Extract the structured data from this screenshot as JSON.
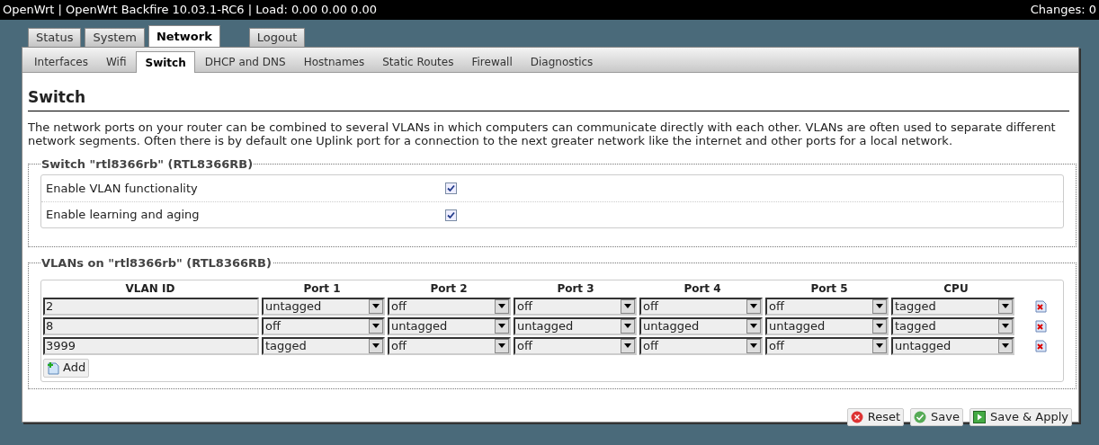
{
  "header": {
    "title": "OpenWrt | OpenWrt Backfire 10.03.1-RC6 | Load: 0.00 0.00 0.00",
    "changes": "Changes: 0"
  },
  "tabs": [
    {
      "label": "Status",
      "selected": false
    },
    {
      "label": "System",
      "selected": false
    },
    {
      "label": "Network",
      "selected": true
    },
    {
      "label": "Logout",
      "selected": false
    }
  ],
  "subtabs": [
    {
      "label": "Interfaces",
      "selected": false
    },
    {
      "label": "Wifi",
      "selected": false
    },
    {
      "label": "Switch",
      "selected": true
    },
    {
      "label": "DHCP and DNS",
      "selected": false
    },
    {
      "label": "Hostnames",
      "selected": false
    },
    {
      "label": "Static Routes",
      "selected": false
    },
    {
      "label": "Firewall",
      "selected": false
    },
    {
      "label": "Diagnostics",
      "selected": false
    }
  ],
  "page_title": "Switch",
  "description": "The network ports on your router can be combined to several VLANs in which computers can communicate directly with each other. VLANs are often used to separate different network segments. Often there is by default one Uplink port for a connection to the next greater network like the internet and other ports for a local network.",
  "switch_section": {
    "legend": "Switch \"rtl8366rb\" (RTL8366RB)",
    "options": [
      {
        "label": "Enable VLAN functionality",
        "checked": true
      },
      {
        "label": "Enable learning and aging",
        "checked": true
      }
    ]
  },
  "vlan_section": {
    "legend": "VLANs on \"rtl8366rb\" (RTL8366RB)",
    "columns": [
      "VLAN ID",
      "Port 1",
      "Port 2",
      "Port 3",
      "Port 4",
      "Port 5",
      "CPU"
    ],
    "rows": [
      {
        "vlan_id": "2",
        "ports": [
          "untagged",
          "off",
          "off",
          "off",
          "off",
          "tagged"
        ]
      },
      {
        "vlan_id": "8",
        "ports": [
          "off",
          "untagged",
          "untagged",
          "untagged",
          "untagged",
          "tagged"
        ]
      },
      {
        "vlan_id": "3999",
        "ports": [
          "tagged",
          "off",
          "off",
          "off",
          "off",
          "untagged"
        ]
      }
    ],
    "add_button": "Add"
  },
  "buttons": [
    {
      "kind": "reset",
      "label": "Reset"
    },
    {
      "kind": "save",
      "label": "Save"
    },
    {
      "kind": "apply",
      "label": "Save & Apply"
    }
  ]
}
